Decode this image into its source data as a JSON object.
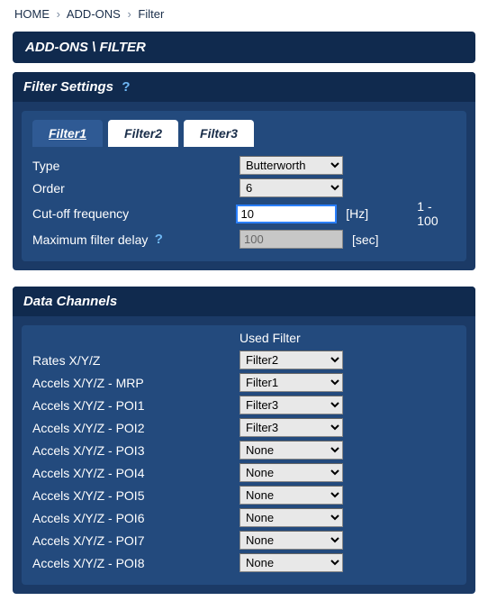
{
  "breadcrumb": {
    "home": "HOME",
    "addons": "ADD-ONS",
    "current": "Filter"
  },
  "page_title": "ADD-ONS \\ FILTER",
  "filter_settings": {
    "header": "Filter Settings",
    "tabs": [
      "Filter1",
      "Filter2",
      "Filter3"
    ],
    "active_tab": "Filter1",
    "rows": {
      "type": {
        "label": "Type",
        "value": "Butterworth",
        "options": [
          "Butterworth"
        ]
      },
      "order": {
        "label": "Order",
        "value": "6",
        "options": [
          "6"
        ]
      },
      "cutoff": {
        "label": "Cut-off frequency",
        "value": "10",
        "unit": "[Hz]",
        "range": "1 - 100"
      },
      "delay": {
        "label": "Maximum filter delay",
        "value": "100",
        "unit": "[sec]"
      }
    }
  },
  "data_channels": {
    "header": "Data Channels",
    "column_header": "Used Filter",
    "filter_options": [
      "None",
      "Filter1",
      "Filter2",
      "Filter3"
    ],
    "rows": [
      {
        "label": "Rates X/Y/Z",
        "value": "Filter2"
      },
      {
        "label": "Accels X/Y/Z - MRP",
        "value": "Filter1"
      },
      {
        "label": "Accels X/Y/Z - POI1",
        "value": "Filter3"
      },
      {
        "label": "Accels X/Y/Z - POI2",
        "value": "Filter3"
      },
      {
        "label": "Accels X/Y/Z - POI3",
        "value": "None"
      },
      {
        "label": "Accels X/Y/Z - POI4",
        "value": "None"
      },
      {
        "label": "Accels X/Y/Z - POI5",
        "value": "None"
      },
      {
        "label": "Accels X/Y/Z - POI6",
        "value": "None"
      },
      {
        "label": "Accels X/Y/Z - POI7",
        "value": "None"
      },
      {
        "label": "Accels X/Y/Z - POI8",
        "value": "None"
      }
    ]
  }
}
